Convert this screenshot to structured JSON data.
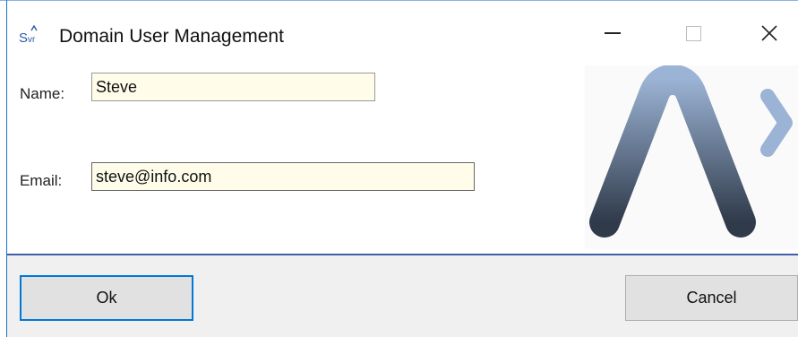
{
  "window": {
    "title": "Domain User Management",
    "icon": "svr-app-icon",
    "icon_text": "Svr"
  },
  "form": {
    "name_label": "Name:",
    "name_value": "Steve",
    "email_label": "Email:",
    "email_value": "steve@info.com"
  },
  "footer": {
    "ok_label": "Ok",
    "cancel_label": "Cancel"
  },
  "logo": {
    "letter": "A",
    "name": "company-logo"
  },
  "colors": {
    "input_bg": "#fffdea",
    "accent": "#0078d7",
    "divider": "#3f5fa8",
    "logo_gradient_top": "#9bb3d4",
    "logo_gradient_bottom": "#2f3a4a"
  }
}
